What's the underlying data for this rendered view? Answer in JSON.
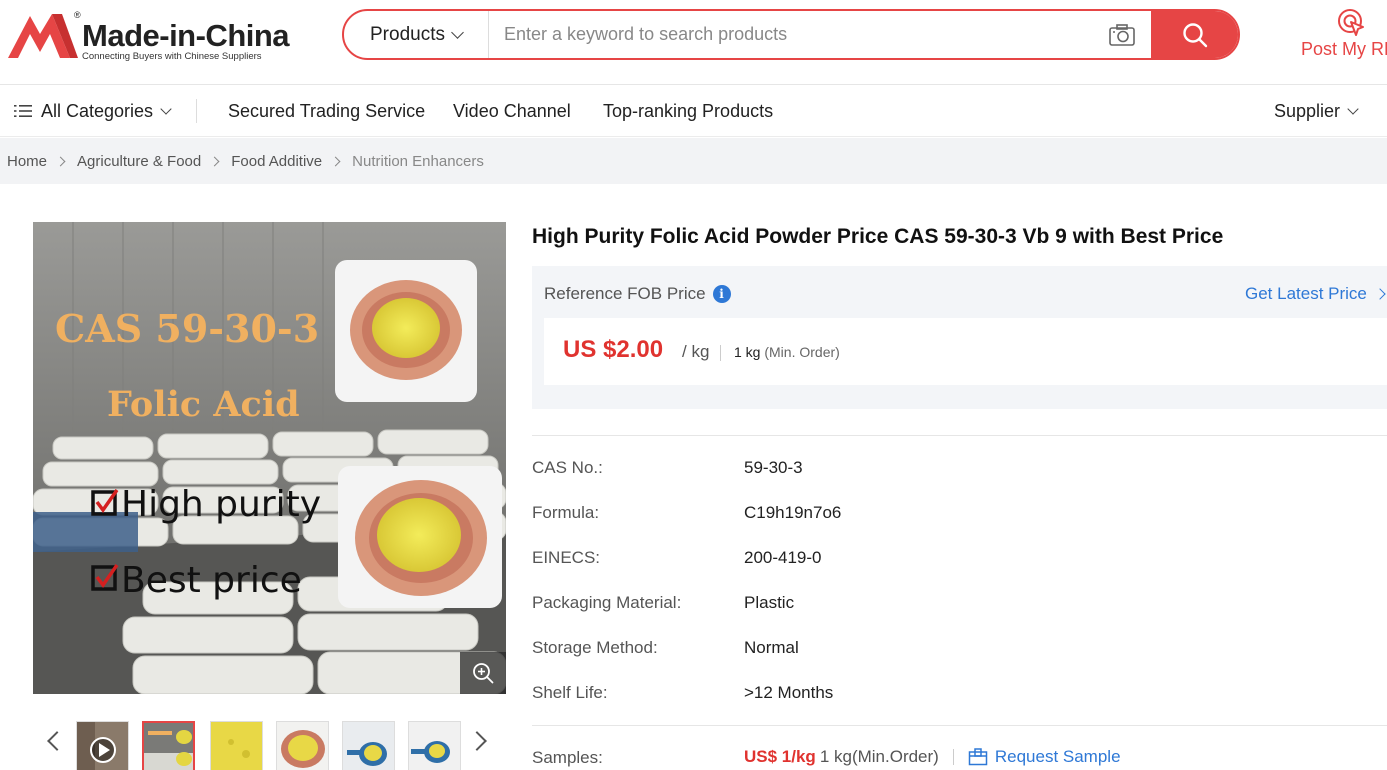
{
  "brand": {
    "name": "Made-in-China",
    "tagline": "Connecting Buyers with Chinese Suppliers",
    "registered_mark": "®",
    "color": "#e64545"
  },
  "search": {
    "category": "Products",
    "placeholder": "Enter a keyword to search products",
    "icons": [
      "camera-icon",
      "search-icon"
    ]
  },
  "header_actions": {
    "post_rfq": "Post My RF"
  },
  "nav": {
    "all_categories": "All Categories",
    "items": [
      "Secured Trading Service",
      "Video Channel",
      "Top-ranking Products"
    ],
    "supplier": "Supplier"
  },
  "breadcrumb": [
    "Home",
    "Agriculture & Food",
    "Food Additive",
    "Nutrition Enhancers"
  ],
  "gallery": {
    "main_image": {
      "headline": "CAS 59-30-3",
      "subheadline": "Folic Acid",
      "bullets": [
        "High purity",
        "Best price"
      ]
    },
    "thumbnail_count": 6,
    "active_thumbnail": 2
  },
  "product": {
    "title": "High Purity Folic Acid Powder Price CAS 59-30-3 Vb 9 with Best Price",
    "price_label": "Reference FOB Price",
    "latest_price_link": "Get Latest Price",
    "price": "US $2.00",
    "price_unit": "/ kg",
    "moq_value": "1 kg",
    "moq_note": "(Min. Order)",
    "price_color": "#e0332f",
    "link_color": "#2e78d6",
    "specs": [
      {
        "label": "CAS No.:",
        "value": "59-30-3"
      },
      {
        "label": "Formula:",
        "value": "C19h19n7o6"
      },
      {
        "label": "EINECS:",
        "value": "200-419-0"
      },
      {
        "label": "Packaging Material:",
        "value": "Plastic"
      },
      {
        "label": "Storage Method:",
        "value": "Normal"
      },
      {
        "label": "Shelf Life:",
        "value": ">12 Months"
      }
    ],
    "samples": {
      "label": "Samples:",
      "price": "US$ 1/kg",
      "moq": "1 kg(Min.Order)",
      "request": "Request Sample"
    }
  }
}
